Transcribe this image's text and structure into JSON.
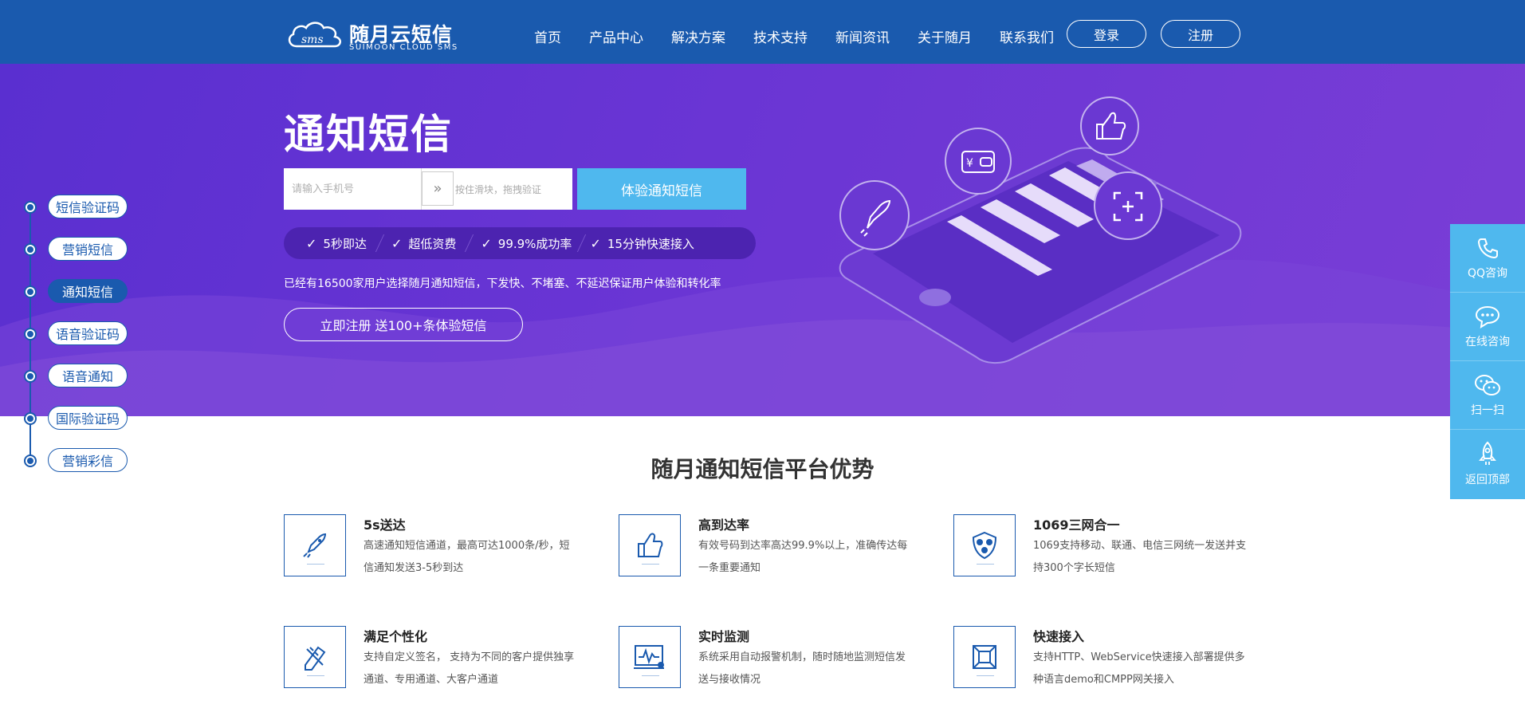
{
  "header": {
    "logo_badge": "sms",
    "logo_cn": "随月云短信",
    "logo_en": "SUIMOON CLOUD SMS",
    "nav": [
      "首页",
      "产品中心",
      "解决方案",
      "技术支持",
      "新闻资讯",
      "关于随月",
      "联系我们"
    ],
    "login": "登录",
    "register": "注册"
  },
  "hero": {
    "title": "通知短信",
    "phone_placeholder": "请输入手机号",
    "slider_text": "按住滑块，拖拽验证",
    "slider_handle": "»",
    "try_button": "体验通知短信",
    "features": [
      "5秒即达",
      "超低资费",
      "99.9%成功率",
      "15分钟快速接入"
    ],
    "check": "✓",
    "desc": "已经有16500家用户选择随月通知短信，下发快、不堵塞、不延迟保证用户体验和转化率",
    "register_button": "立即注册 送100+条体验短信",
    "illustration_icons": [
      "rocket-icon",
      "wallet-icon",
      "thumbs-up-icon",
      "scan-icon"
    ]
  },
  "timeline": {
    "items": [
      "短信验证码",
      "营销短信",
      "通知短信",
      "语音验证码",
      "语音通知",
      "国际验证码",
      "营销彩信"
    ],
    "active_index": 2
  },
  "sidebar": {
    "items": [
      {
        "label": "QQ咨询",
        "icon": "phone-icon"
      },
      {
        "label": "在线咨询",
        "icon": "chat-icon"
      },
      {
        "label": "扫一扫",
        "icon": "wechat-icon"
      },
      {
        "label": "返回顶部",
        "icon": "rocket-icon"
      }
    ]
  },
  "advantages": {
    "title": "随月通知短信平台优势",
    "items": [
      {
        "title": "5s送达",
        "desc": "高速通知短信通道，最高可达1000条/秒，短信通知发送3-5秒到达",
        "icon": "rocket-icon"
      },
      {
        "title": "高到达率",
        "desc": "有效号码到达率高达99.9%以上，准确传达每一条重要通知",
        "icon": "thumbs-up-icon"
      },
      {
        "title": "1069三网合一",
        "desc": "1069支持移动、联通、电信三网统一发送并支持300个字长短信",
        "icon": "network-icon"
      },
      {
        "title": "满足个性化",
        "desc": "支持自定义签名， 支持为不同的客户提供独享通道、专用通道、大客户通道",
        "icon": "pencil-ruler-icon"
      },
      {
        "title": "实时监测",
        "desc": "系统采用自动报警机制，随时随地监测短信发送与接收情况",
        "icon": "monitor-icon"
      },
      {
        "title": "快速接入",
        "desc": "支持HTTP、WebService快速接入部署提供多种语言demo和CMPP网关接入",
        "icon": "cube-icon"
      }
    ]
  },
  "colors": {
    "header": "#1a5aae",
    "hero": "#6a35d4",
    "accent": "#4fb8ee"
  }
}
